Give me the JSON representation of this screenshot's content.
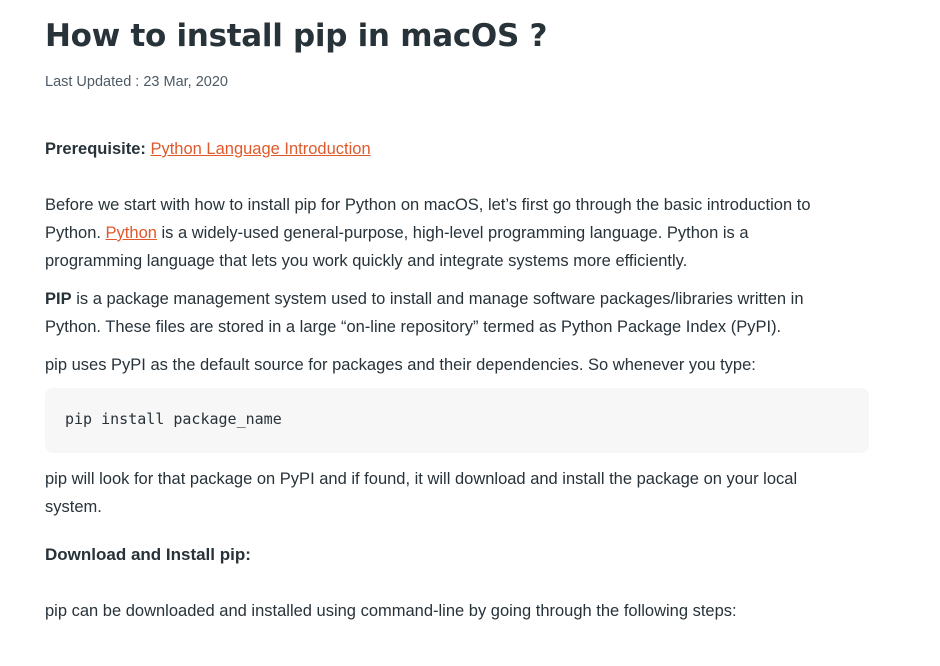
{
  "article": {
    "title": "How to install pip in macOS ?",
    "last_updated": "Last Updated : 23 Mar, 2020",
    "prerequisite": {
      "label": "Prerequisite:",
      "link_text": "Python Language Introduction"
    },
    "intro": {
      "line1": "Before we start with how to install pip for Python on macOS, let’s first go through the basic introduction to",
      "line2_pre": "Python. ",
      "line2_link": "Python",
      "line2_post": " is a widely-used general-purpose, high-level programming language. Python is a",
      "line3": "programming language that lets you work quickly and integrate systems more efficiently."
    },
    "pip_def": {
      "bold": "PIP",
      "line1_rest": " is a package management system used to install and manage software packages/libraries written in",
      "line2": "Python. These files are stored in a large “on-line repository” termed as Python Package Index (PyPI)."
    },
    "pypi_usage": "pip uses PyPI as the default source for packages and their dependencies. So whenever you type:",
    "code": "pip install package_name",
    "lookup": {
      "line1": "pip will look for that package on PyPI and if found, it will download and install the package on your local",
      "line2": "system."
    },
    "download_heading": "Download and Install pip:",
    "steps_intro": "pip can be downloaded and installed using command-line by going through the following steps:"
  },
  "colors": {
    "text": "#273239",
    "link": "#e0592a",
    "code_bg": "#f7f7f7"
  }
}
